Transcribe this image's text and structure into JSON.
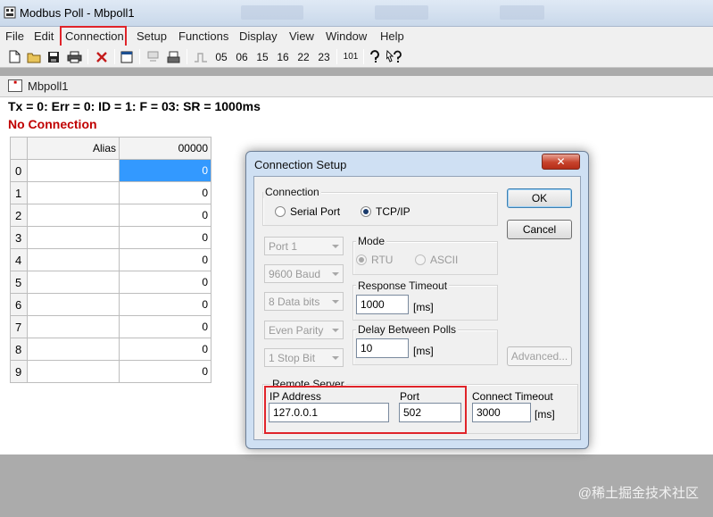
{
  "window": {
    "title": "Modbus Poll - Mbpoll1"
  },
  "menu": [
    "File",
    "Edit",
    "Connection",
    "Setup",
    "Functions",
    "Display",
    "View",
    "Window",
    "Help"
  ],
  "toolbar": {
    "function_buttons": [
      "05",
      "06",
      "15",
      "16",
      "22",
      "23"
    ],
    "comm_label": "101"
  },
  "child": {
    "title": "Mbpoll1",
    "status": "Tx = 0: Err = 0: ID = 1: F = 03: SR = 1000ms",
    "connection_status": "No Connection",
    "grid": {
      "alias_header": "Alias",
      "value_header": "00000",
      "rows": [
        {
          "index": "0",
          "value": "0"
        },
        {
          "index": "1",
          "value": "0"
        },
        {
          "index": "2",
          "value": "0"
        },
        {
          "index": "3",
          "value": "0"
        },
        {
          "index": "4",
          "value": "0"
        },
        {
          "index": "5",
          "value": "0"
        },
        {
          "index": "6",
          "value": "0"
        },
        {
          "index": "7",
          "value": "0"
        },
        {
          "index": "8",
          "value": "0"
        },
        {
          "index": "9",
          "value": "0"
        }
      ]
    }
  },
  "dialog": {
    "title": "Connection Setup",
    "close_label": "✕",
    "connection_group": "Connection",
    "serial_port": "Serial Port",
    "tcpip": "TCP/IP",
    "port_combo": "Port 1",
    "baud_combo": "9600 Baud",
    "databits_combo": "8 Data bits",
    "parity_combo": "Even Parity",
    "stopbit_combo": "1 Stop Bit",
    "mode_group": "Mode",
    "rtu": "RTU",
    "ascii": "ASCII",
    "response_timeout_label": "Response Timeout",
    "response_timeout_value": "1000",
    "delay_label": "Delay Between Polls",
    "delay_value": "10",
    "ms_unit": "[ms]",
    "remote_server_label": "Remote Server",
    "ip_label": "IP Address",
    "ip_value": "127.0.0.1",
    "port_label": "Port",
    "port_value": "502",
    "connect_timeout_label": "Connect Timeout",
    "connect_timeout_value": "3000",
    "ok_label": "OK",
    "cancel_label": "Cancel",
    "advanced_label": "Advanced..."
  },
  "watermark": "@稀土掘金技术社区",
  "colors": {
    "highlight_box": "#e0242a",
    "no_connection": "#c00000",
    "selected_cell": "#3399ff"
  }
}
